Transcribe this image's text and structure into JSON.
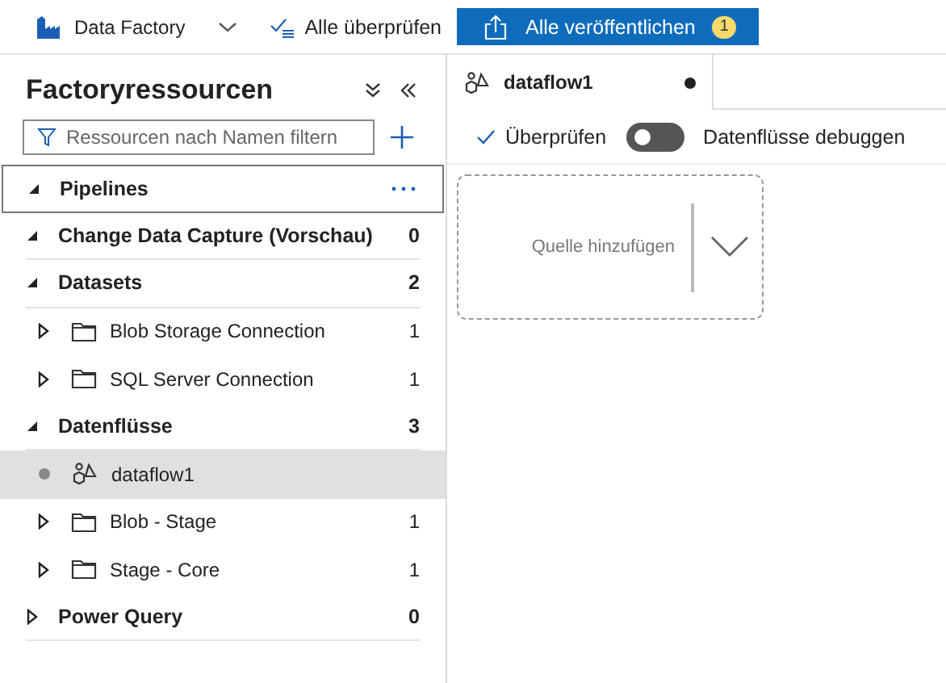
{
  "toolbar": {
    "factory_name": "Data Factory",
    "validate_all": "Alle überprüfen",
    "publish_all": "Alle veröffentlichen",
    "publish_count": "1"
  },
  "sidebar": {
    "title": "Factoryressourcen",
    "filter": {
      "placeholder": "Ressourcen nach Namen filtern"
    },
    "tree": [
      {
        "kind": "category",
        "label": "Pipelines",
        "expanded": true,
        "focused": true,
        "selected": false
      },
      {
        "kind": "category",
        "label": "Change Data Capture (Vorschau)",
        "count": "0",
        "expanded": true,
        "focused": false,
        "selected": false
      },
      {
        "kind": "category",
        "label": "Datasets",
        "count": "2",
        "expanded": true,
        "focused": false,
        "selected": false,
        "children": [
          {
            "kind": "folder",
            "label": "Blob Storage Connection",
            "count": "1",
            "selected": false
          },
          {
            "kind": "folder",
            "label": "SQL Server Connection",
            "count": "1",
            "selected": false
          }
        ]
      },
      {
        "kind": "category",
        "label": "Datenflüsse",
        "count": "3",
        "expanded": true,
        "focused": false,
        "selected": false,
        "children": [
          {
            "kind": "dataflow",
            "label": "dataflow1",
            "selected": true
          },
          {
            "kind": "folder",
            "label": "Blob - Stage",
            "count": "1",
            "selected": false
          },
          {
            "kind": "folder",
            "label": "Stage - Core",
            "count": "1",
            "selected": false
          }
        ]
      },
      {
        "kind": "category",
        "label": "Power Query",
        "count": "0",
        "expanded": false,
        "focused": false,
        "selected": false
      }
    ]
  },
  "editor": {
    "tab": {
      "label": "dataflow1",
      "unsaved": true
    },
    "validate": "Überprüfen",
    "debug": {
      "label": "Datenflüsse debuggen",
      "on": false
    },
    "source_card": "Quelle hinzufügen"
  }
}
